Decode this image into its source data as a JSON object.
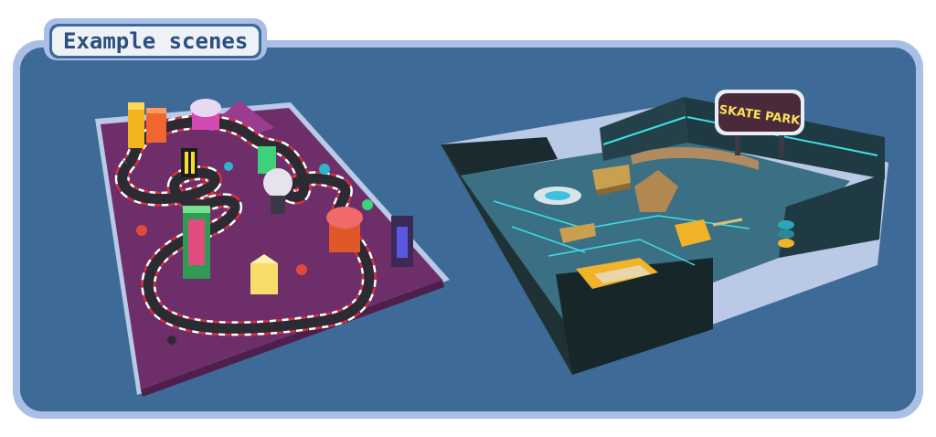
{
  "header": {
    "title": "Example scenes"
  },
  "scenes": [
    {
      "name": "race-track-city",
      "icon": "race-track-scene"
    },
    {
      "name": "skate-park",
      "sign_text": "SKATE PARK",
      "icon": "skate-park-scene"
    }
  ],
  "colors": {
    "panel_bg": "#3d6a96",
    "panel_border": "#a9bfe6",
    "title_text": "#2b4f80",
    "track_ground": "#6e2e6a",
    "skate_floor": "#3a6f84"
  }
}
